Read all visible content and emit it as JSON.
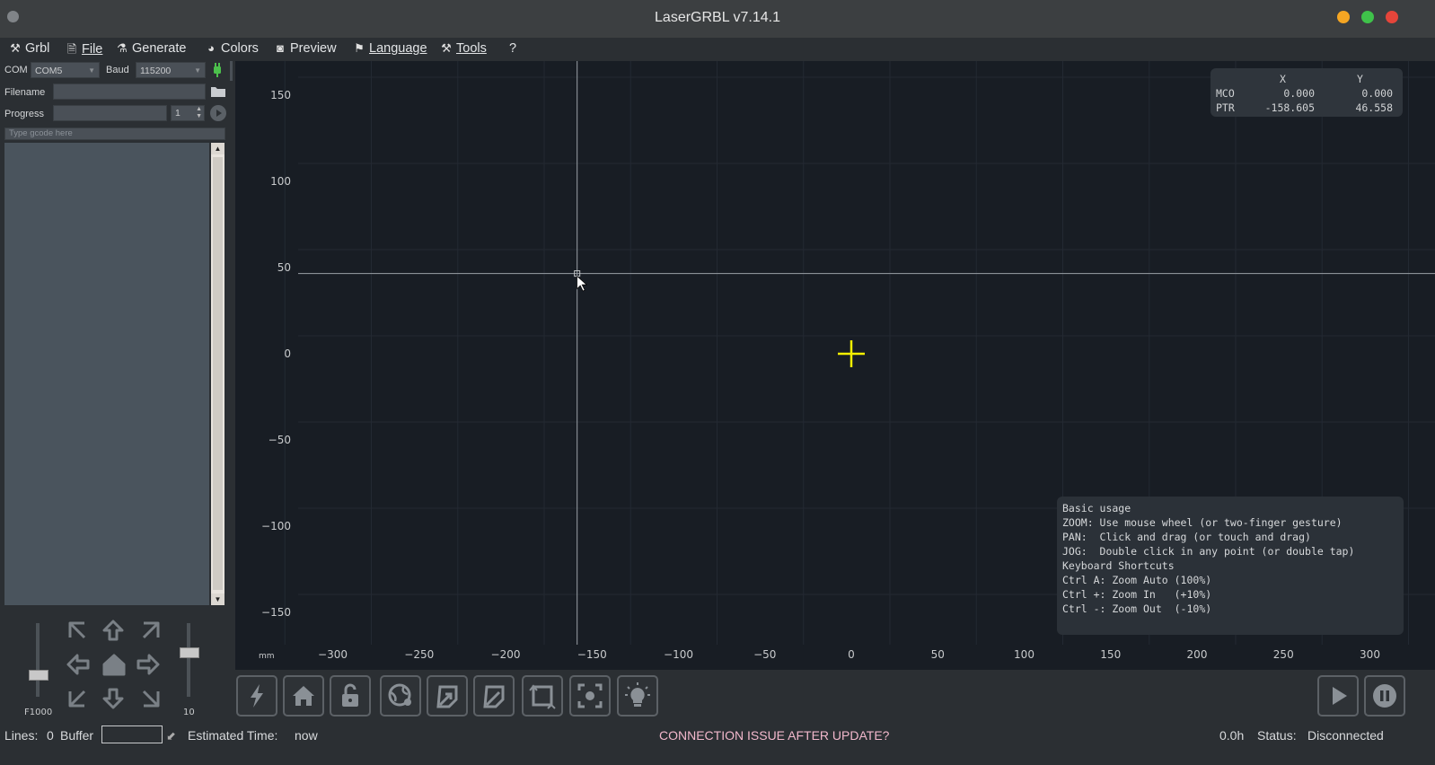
{
  "window": {
    "title": "LaserGRBL v7.14.1",
    "controls": {
      "minimize_color": "#f5a623",
      "maximize_color": "#3fc24a",
      "close_color": "#e5453a"
    }
  },
  "menu": [
    {
      "icon": "wrench-icon",
      "label": "Grbl"
    },
    {
      "icon": "file-icon",
      "label": "File"
    },
    {
      "icon": "flask-icon",
      "label": "Generate"
    },
    {
      "icon": "palette-icon",
      "label": "Colors"
    },
    {
      "icon": "preview-icon",
      "label": "Preview"
    },
    {
      "icon": "flag-icon",
      "label": "Language"
    },
    {
      "icon": "tools-icon",
      "label": "Tools"
    },
    {
      "icon": "",
      "label": "?"
    }
  ],
  "connection": {
    "com_label": "COM",
    "com_value": "COM5",
    "baud_label": "Baud",
    "baud_value": "115200",
    "filename_label": "Filename",
    "filename_value": "",
    "progress_label": "Progress",
    "progress_copies": "1",
    "gcode_placeholder": "Type gcode here"
  },
  "sliders": {
    "feed_label": "F1000",
    "step_label": "10"
  },
  "coords": {
    "x_header": "X",
    "y_header": "Y",
    "rows": [
      {
        "label": "MCO",
        "x": "0.000",
        "y": "0.000"
      },
      {
        "label": "PTR",
        "x": "-158.605",
        "y": "46.558"
      }
    ]
  },
  "help": [
    "Basic usage",
    "ZOOM: Use mouse wheel (or two-finger gesture)",
    "PAN:  Click and drag (or touch and drag)",
    "JOG:  Double click in any point (or double tap)",
    "Keyboard Shortcuts",
    "Ctrl A: Zoom Auto (100%)",
    "Ctrl +: Zoom In   (+10%)",
    "Ctrl -: Zoom Out  (-10%)"
  ],
  "axes": {
    "unit": "mm",
    "x_ticks": [
      "−300",
      "−250",
      "−200",
      "−150",
      "−100",
      "−50",
      "0",
      "50",
      "100",
      "150",
      "200",
      "250",
      "300"
    ],
    "y_ticks": [
      "150",
      "100",
      "50",
      "0",
      "−50",
      "−100",
      "−150"
    ],
    "crosshair_color": "#f5f000"
  },
  "toolbar_icons": [
    "flash-icon",
    "home-icon",
    "unlock-icon",
    "globe-pin-icon",
    "center-icon",
    "edit-icon",
    "frame-icon",
    "focus-icon",
    "bulb-icon"
  ],
  "status": {
    "lines_label": "Lines:",
    "lines_value": "0",
    "buffer_label": "Buffer",
    "est_label": "Estimated Time:",
    "est_value": "now",
    "issue_text": "CONNECTION ISSUE AFTER UPDATE?",
    "issue_color": "#f2b8cc",
    "time_value": "0.0h",
    "status_label": "Status:",
    "status_value": "Disconnected"
  }
}
